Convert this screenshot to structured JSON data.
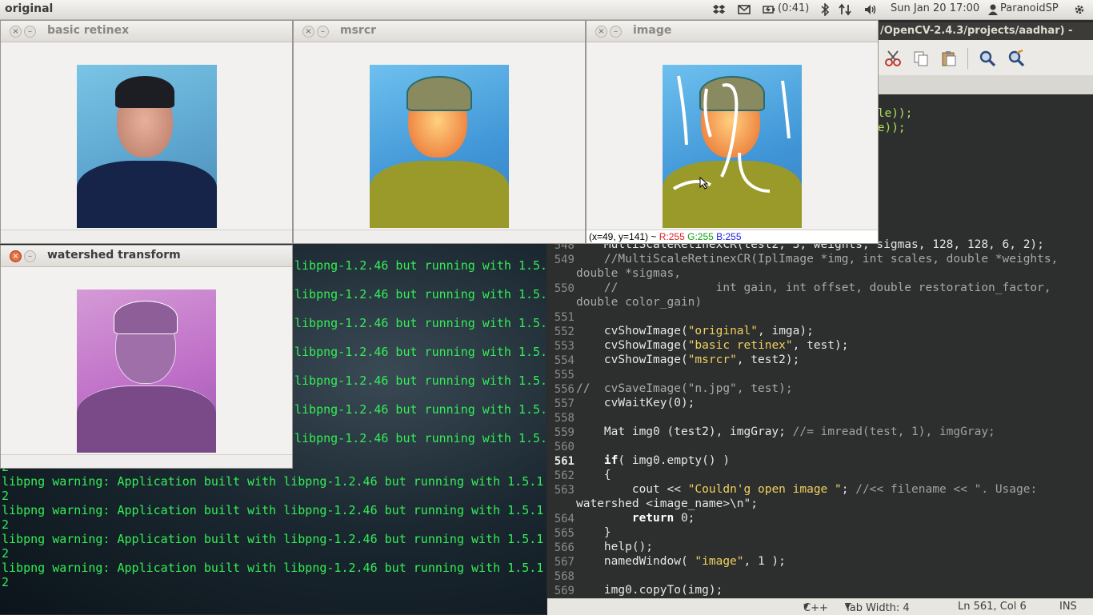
{
  "top_panel": {
    "app_title": "original",
    "battery": "(0:41)",
    "datetime": "Sun Jan 20 17:00",
    "user": "ParanoidSP",
    "icons": [
      "dropbox-icon",
      "mail-icon",
      "battery-icon",
      "bluetooth-icon",
      "network-icon",
      "volume-icon",
      "user-icon",
      "power-gear-icon"
    ]
  },
  "windows": {
    "basic_retinex": {
      "title": "basic retinex"
    },
    "msrcr": {
      "title": "msrcr"
    },
    "image": {
      "title": "image",
      "readout_pos": "(x=49, y=141) ~",
      "r": "R:255",
      "g": "G:255",
      "b": "B:255"
    },
    "watershed": {
      "title": "watershed transform"
    }
  },
  "editor": {
    "title_fragment": "/OpenCV-2.4.3/projects/aadhar) -",
    "top_fragments": [
      "ble));",
      "le));"
    ],
    "lines": [
      {
        "n": "548",
        "t": "    MultiScaleRetinexCR(test2, 3, weights, sigmas, 128, 128, 6, 2);"
      },
      {
        "n": "549",
        "t": "    //MultiScaleRetinexCR(IplImage *img, int scales, double *weights,"
      },
      {
        "n": "",
        "t": "double *sigmas,"
      },
      {
        "n": "550",
        "t": "    //              int gain, int offset, double restoration_factor,"
      },
      {
        "n": "",
        "t": "double color_gain)"
      },
      {
        "n": "551",
        "t": ""
      },
      {
        "n": "552",
        "t": "    cvShowImage(\"original\", imga);"
      },
      {
        "n": "553",
        "t": "    cvShowImage(\"basic retinex\", test);"
      },
      {
        "n": "554",
        "t": "    cvShowImage(\"msrcr\", test2);"
      },
      {
        "n": "555",
        "t": ""
      },
      {
        "n": "556",
        "t": "//  cvSaveImage(\"n.jpg\", test);"
      },
      {
        "n": "557",
        "t": "    cvWaitKey(0);"
      },
      {
        "n": "558",
        "t": ""
      },
      {
        "n": "559",
        "t": "    Mat img0 (test2), imgGray; //= imread(test, 1), imgGray;"
      },
      {
        "n": "560",
        "t": ""
      },
      {
        "n": "561",
        "t": "    if( img0.empty() )"
      },
      {
        "n": "562",
        "t": "    {"
      },
      {
        "n": "563",
        "t": "        cout << \"Couldn'g open image \"; //<< filename << \". Usage:"
      },
      {
        "n": "",
        "t": "watershed <image_name>\\n\";"
      },
      {
        "n": "564",
        "t": "        return 0;"
      },
      {
        "n": "565",
        "t": "    }"
      },
      {
        "n": "566",
        "t": "    help();"
      },
      {
        "n": "567",
        "t": "    namedWindow( \"image\", 1 );"
      },
      {
        "n": "568",
        "t": ""
      },
      {
        "n": "569",
        "t": "    img0.copyTo(img);"
      }
    ],
    "status": {
      "language": "C++",
      "tab_width": "Tab Width: 4",
      "position": "Ln 561, Col 6",
      "mode": "INS"
    }
  },
  "terminal": {
    "lines_partial": [
      "libpng-1.2.46 but running with 1.5.1",
      "libpng-1.2.46 but running with 1.5.1",
      "libpng-1.2.46 but running with 1.5.1",
      "libpng-1.2.46 but running with 1.5.1",
      "libpng-1.2.46 but running with 1.5.1",
      "libpng-1.2.46 but running with 1.5.1",
      "libpng-1.2.46 but running with 1.5.1"
    ],
    "warning": "libpng warning: Application built with libpng-1.2.46 but running with 1.5.1",
    "count": "2"
  },
  "colors": {
    "terminal_text": "#33ee55",
    "editor_bg": "#2d2f2f",
    "string": "#f0d060"
  }
}
